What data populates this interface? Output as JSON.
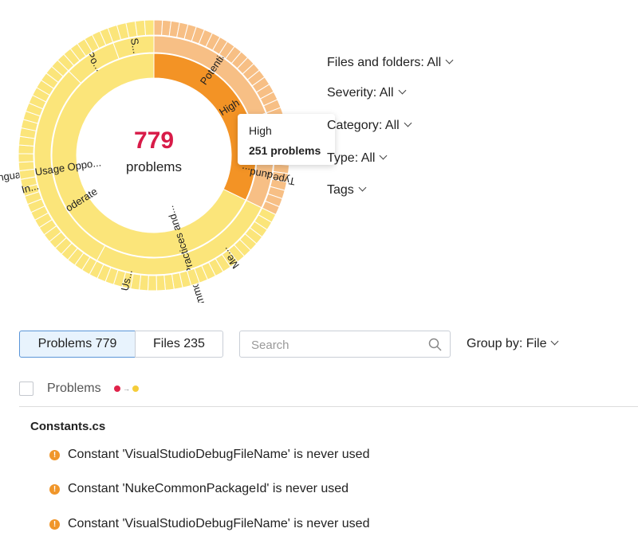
{
  "chart_data": {
    "type": "sunburst",
    "total": 779,
    "total_label": "problems",
    "levels": [
      {
        "name": "Severity",
        "segments": [
          {
            "label": "High",
            "value": 251,
            "color": "#f39325"
          },
          {
            "label": "Moderate",
            "value": 528,
            "color": "#fbe57a"
          }
        ]
      },
      {
        "name": "Category",
        "segments": [
          {
            "label": "Potential...",
            "parent": "High",
            "value": 150,
            "color": "#f7bf85"
          },
          {
            "label": "R...",
            "parent": "High",
            "value": 30,
            "color": "#f7bf85"
          },
          {
            "label": "Redund...",
            "parent": "High",
            "value": 71,
            "color": "#f7bf85"
          },
          {
            "label": "Common Practices and...",
            "parent": "Moderate",
            "value": 200,
            "color": "#fbe57a"
          },
          {
            "label": "Language Usage Oppo...",
            "parent": "Moderate",
            "value": 230,
            "color": "#fbe57a"
          },
          {
            "label": "Po...",
            "parent": "Moderate",
            "value": 55,
            "color": "#fbe57a"
          },
          {
            "label": "S...",
            "parent": "Moderate",
            "value": 43,
            "color": "#fbe57a"
          }
        ]
      },
      {
        "name": "Type",
        "labels": [
          "Type...",
          "Me...",
          "Us...",
          "In..."
        ]
      }
    ]
  },
  "tooltip": {
    "title": "High",
    "value": "251 problems"
  },
  "filters": [
    "Files and folders: All",
    "Severity: All",
    "Category: All",
    "Type: All",
    "Tags"
  ],
  "tabs": [
    {
      "label": "Problems 779",
      "active": true
    },
    {
      "label": "Files 235",
      "active": false
    }
  ],
  "search": {
    "placeholder": "Search",
    "value": ""
  },
  "group_by": "Group by: File",
  "list": {
    "header": "Problems",
    "sort_colors": [
      "#e0234a",
      "#f5cd3a"
    ],
    "file": "Constants.cs",
    "items": [
      "Constant 'VisualStudioDebugFileName' is never used",
      "Constant 'NukeCommonPackageId' is never used",
      "Constant 'VisualStudioDebugFileName' is never used"
    ]
  }
}
